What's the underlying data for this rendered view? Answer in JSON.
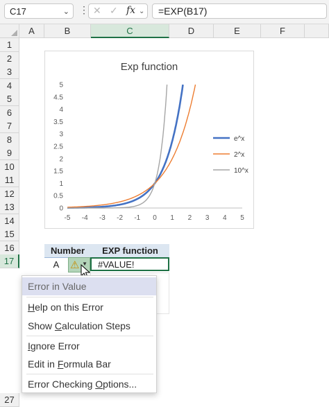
{
  "formula_bar": {
    "name_box": "C17",
    "formula": "=EXP(B17)",
    "cancel_icon": "✕",
    "enter_icon": "✓",
    "fx_label": "fx"
  },
  "columns": [
    "A",
    "B",
    "C",
    "D",
    "E",
    "F"
  ],
  "rows": [
    "1",
    "2",
    "3",
    "4",
    "5",
    "6",
    "7",
    "8",
    "9",
    "10",
    "11",
    "12",
    "13",
    "14",
    "15",
    "16",
    "17",
    "27"
  ],
  "chart_data": {
    "type": "line",
    "title": "Exp function",
    "xlabel": "",
    "ylabel": "",
    "xlim": [
      -5,
      5
    ],
    "ylim": [
      0,
      5
    ],
    "x_ticks": [
      "-5",
      "-4",
      "-3",
      "-2",
      "-1",
      "0",
      "1",
      "2",
      "3",
      "4",
      "5"
    ],
    "y_ticks": [
      "0",
      "0.5",
      "1",
      "1.5",
      "2",
      "2.5",
      "3",
      "3.5",
      "4",
      "4.5",
      "5"
    ],
    "grid": false,
    "legend_position": "right",
    "series": [
      {
        "name": "e^x",
        "color": "#4472c4",
        "function": "exp(x)",
        "x": [
          -5,
          -4,
          -3,
          -2,
          -1,
          0,
          0.5,
          1,
          1.5,
          1.609
        ],
        "y": [
          0.007,
          0.018,
          0.05,
          0.135,
          0.368,
          1,
          1.649,
          2.718,
          4.482,
          5
        ]
      },
      {
        "name": "2^x",
        "color": "#ed7d31",
        "function": "2^x",
        "x": [
          -5,
          -4,
          -3,
          -2,
          -1,
          0,
          1,
          1.5,
          2,
          2.322
        ],
        "y": [
          0.031,
          0.063,
          0.125,
          0.25,
          0.5,
          1,
          2,
          2.828,
          4,
          5
        ]
      },
      {
        "name": "10^x",
        "color": "#a5a5a5",
        "function": "10^x",
        "x": [
          -5,
          -3,
          -2,
          -1,
          -0.5,
          0,
          0.3,
          0.5,
          0.699
        ],
        "y": [
          0,
          0.001,
          0.01,
          0.1,
          0.316,
          1,
          1.995,
          3.162,
          5
        ]
      }
    ]
  },
  "table": {
    "headers": [
      "Number",
      "EXP function"
    ],
    "row17": {
      "number": "A",
      "result": "#VALUE!"
    }
  },
  "error_button": {
    "icon": "warning-icon",
    "glyph": "⚠",
    "dropdown": "▼"
  },
  "context_menu": {
    "header": "Error in Value",
    "items": [
      {
        "label": "Help on this Error",
        "underline": "H"
      },
      {
        "label": "Show Calculation Steps",
        "underline": "C"
      },
      {
        "label": "Ignore Error",
        "underline": "I"
      },
      {
        "label": "Edit in Formula Bar",
        "underline": "F"
      },
      {
        "label": "Error Checking Options...",
        "underline": "O"
      }
    ]
  },
  "colors": {
    "accent": "#1e7145",
    "table_header": "#dce6f1"
  }
}
